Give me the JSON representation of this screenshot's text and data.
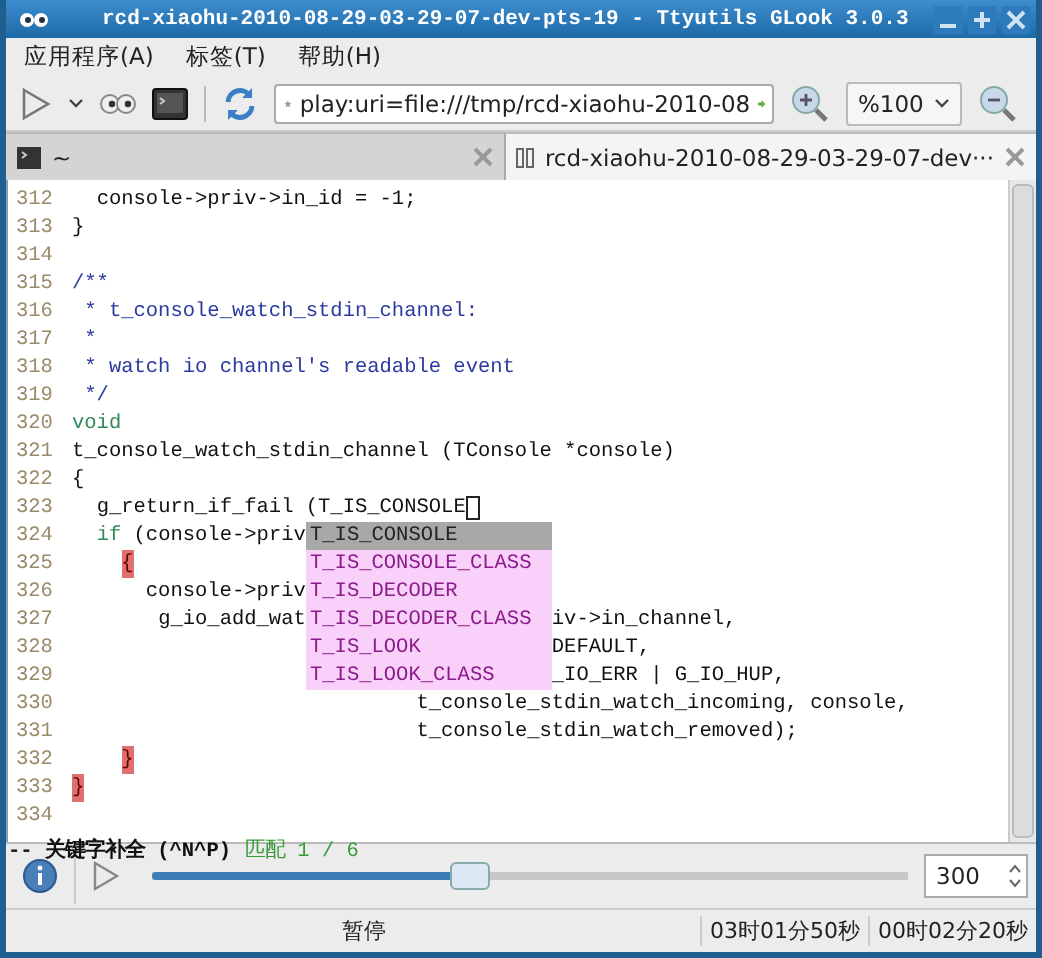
{
  "window": {
    "title": "rcd-xiaohu-2010-08-29-03-29-07-dev-pts-19 - Ttyutils GLook 3.0.3"
  },
  "menu": [
    {
      "label": "应用程序(A)"
    },
    {
      "label": "标签(T)"
    },
    {
      "label": "帮助(H)"
    }
  ],
  "toolbar": {
    "url": "play:uri=file:///tmp/rcd-xiaohu-2010-08",
    "zoom": "%100"
  },
  "tabs": [
    {
      "label": "~",
      "selected": false,
      "kind": "terminal"
    },
    {
      "label": "rcd-xiaohu-2010-08-29-03-29-07-dev···",
      "selected": true,
      "kind": "playback"
    }
  ],
  "editor": {
    "lines": [
      {
        "num": "312",
        "segments": [
          {
            "text": "  console->priv->in_id = -1;",
            "kind": "plain"
          }
        ]
      },
      {
        "num": "313",
        "segments": [
          {
            "text": "}",
            "kind": "plain"
          }
        ]
      },
      {
        "num": "314"
      },
      {
        "num": "315",
        "segments": [
          {
            "text": "/**",
            "kind": "comment"
          }
        ]
      },
      {
        "num": "316",
        "segments": [
          {
            "text": " * t_console_watch_stdin_channel:",
            "kind": "comment"
          }
        ]
      },
      {
        "num": "317",
        "segments": [
          {
            "text": " *",
            "kind": "comment"
          }
        ]
      },
      {
        "num": "318",
        "segments": [
          {
            "text": " * watch io channel's readable event",
            "kind": "comment"
          }
        ]
      },
      {
        "num": "319",
        "segments": [
          {
            "text": " */",
            "kind": "comment"
          }
        ]
      },
      {
        "num": "320",
        "segments": [
          {
            "text": "void",
            "kind": "keyword"
          }
        ]
      },
      {
        "num": "321",
        "segments": [
          {
            "text": "t_console_watch_stdin_channel (TConsole *console)",
            "kind": "plain"
          }
        ]
      },
      {
        "num": "322",
        "segments": [
          {
            "text": "{",
            "kind": "plain"
          }
        ]
      },
      {
        "num": "323",
        "segments": [
          {
            "text": "  g_return_if_fail (T_IS_CONSOLE",
            "kind": "plain"
          }
        ],
        "cursor": true
      },
      {
        "num": "324",
        "segments": [
          {
            "text": "  if",
            "kind": "keyword"
          },
          {
            "text": " (console->priv",
            "kind": "plain"
          }
        ]
      },
      {
        "num": "325",
        "segments": [
          {
            "text": "    {",
            "kind": "brace"
          }
        ]
      },
      {
        "num": "326",
        "segments": [
          {
            "text": "      console->priv",
            "kind": "plain"
          }
        ]
      },
      {
        "num": "327",
        "segments": [
          {
            "text": "       g_io_add_wat",
            "kind": "plain"
          },
          {
            "text": "                    iv->in_channel,",
            "kind": "plain"
          }
        ]
      },
      {
        "num": "328",
        "segments": [
          {
            "text": "                                       DEFAULT,",
            "kind": "plain"
          }
        ]
      },
      {
        "num": "329",
        "segments": [
          {
            "text": "                                       _IO_ERR | G_IO_HUP,",
            "kind": "plain"
          }
        ]
      },
      {
        "num": "330",
        "segments": [
          {
            "text": "                            t_console_stdin_watch_incoming, console,",
            "kind": "plain"
          }
        ]
      },
      {
        "num": "331",
        "segments": [
          {
            "text": "                            t_console_stdin_watch_removed);",
            "kind": "plain"
          }
        ]
      },
      {
        "num": "332",
        "segments": [
          {
            "text": "    }",
            "kind": "brace"
          }
        ]
      },
      {
        "num": "333",
        "segments": [
          {
            "text": "}",
            "kind": "brace"
          }
        ]
      },
      {
        "num": "334"
      }
    ],
    "completion": [
      {
        "label": "T_IS_CONSOLE",
        "selected": true
      },
      {
        "label": "T_IS_CONSOLE_CLASS",
        "selected": false
      },
      {
        "label": "T_IS_DECODER",
        "selected": false
      },
      {
        "label": "T_IS_DECODER_CLASS",
        "selected": false
      },
      {
        "label": "T_IS_LOOK",
        "selected": false
      },
      {
        "label": "T_IS_LOOK_CLASS",
        "selected": false
      }
    ]
  },
  "status_line": [
    {
      "text": "-- 关键字补全 (^N^P)",
      "kind": "mode"
    },
    {
      "text": "匹配 1 / 6",
      "kind": "match"
    }
  ],
  "player": {
    "level": 0.42,
    "value": "300"
  },
  "status_bar": {
    "state": "暂停",
    "total": "03时01分50秒",
    "elapsed": "00时02分20秒"
  }
}
